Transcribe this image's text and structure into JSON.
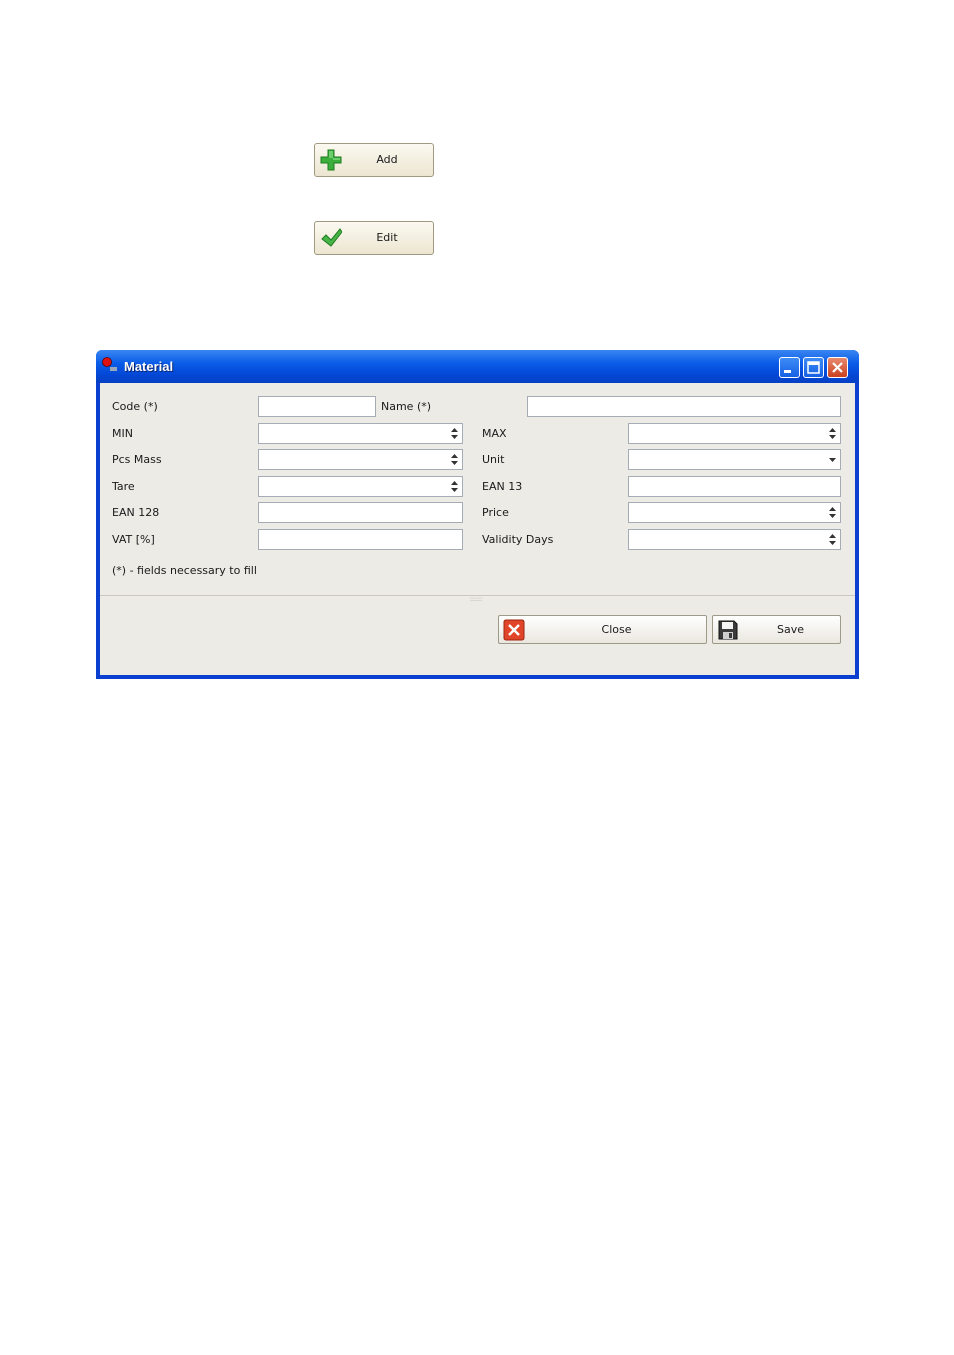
{
  "buttons_top": {
    "add_label": "Add",
    "edit_label": "Edit"
  },
  "window": {
    "title": "Material",
    "fields": {
      "code_label": "Code (*)",
      "name_label": "Name (*)",
      "min_label": "MIN",
      "max_label": "MAX",
      "pcs_mass_label": "Pcs Mass",
      "unit_label": "Unit",
      "tare_label": "Tare",
      "ean13_label": "EAN 13",
      "ean128_label": "EAN 128",
      "price_label": "Price",
      "vat_label": "VAT [%]",
      "validity_days_label": "Validity Days"
    },
    "note": "(*) - fields necessary to fill",
    "close_label": "Close",
    "save_label": "Save"
  }
}
